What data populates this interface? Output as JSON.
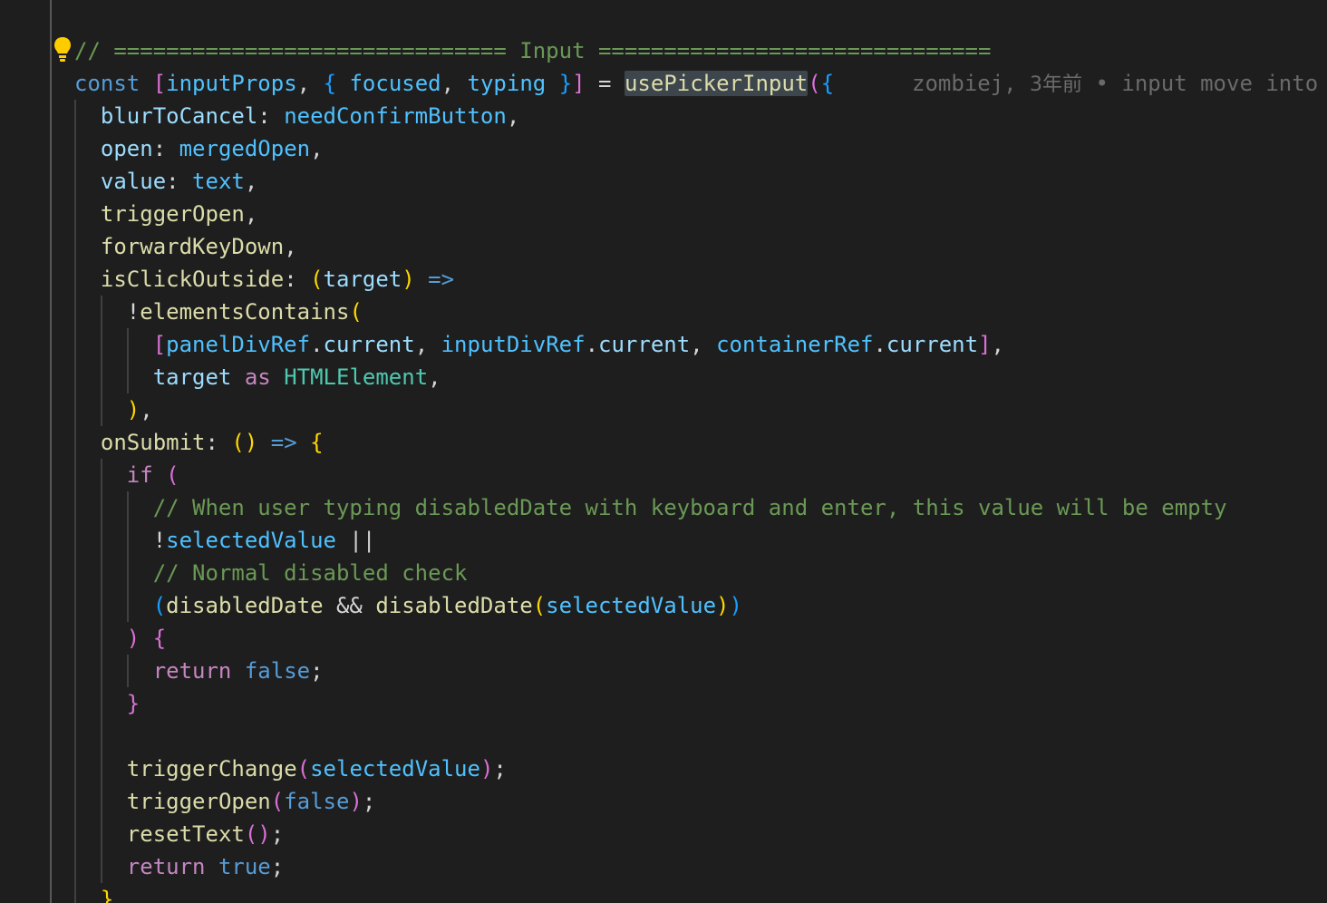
{
  "editor": {
    "colors": {
      "background": "#1e1e1e",
      "comment": "#6a9955",
      "keyword_storage": "#569cd6",
      "keyword_control": "#c586c0",
      "variable": "#9cdcfe",
      "constant": "#4fc1ff",
      "function": "#dcdcaa",
      "type": "#4ec9b0",
      "punctuation": "#d4d4d4",
      "bracket_gold": "#ffd700",
      "bracket_purple": "#da70d6",
      "bracket_blue": "#179fff",
      "indent_guide": "#404040",
      "blame": "#6a6a6a"
    },
    "code_lines": [
      {
        "indent": 0,
        "tokens": [
          {
            "text": "// ============================== Input ==============================",
            "kind": "comment"
          }
        ]
      },
      {
        "indent": 0,
        "tokens": [
          {
            "text": "const",
            "kind": "keyword_storage"
          },
          {
            "text": " ",
            "kind": "punctuation"
          },
          {
            "text": "[",
            "kind": "bracket_purple"
          },
          {
            "text": "inputProps",
            "kind": "constant"
          },
          {
            "text": ", ",
            "kind": "punctuation"
          },
          {
            "text": "{",
            "kind": "bracket_blue"
          },
          {
            "text": " ",
            "kind": "punctuation"
          },
          {
            "text": "focused",
            "kind": "constant"
          },
          {
            "text": ", ",
            "kind": "punctuation"
          },
          {
            "text": "typing",
            "kind": "constant"
          },
          {
            "text": " ",
            "kind": "punctuation"
          },
          {
            "text": "}",
            "kind": "bracket_blue"
          },
          {
            "text": "]",
            "kind": "bracket_purple"
          },
          {
            "text": " = ",
            "kind": "punctuation"
          },
          {
            "text": "usePickerInput",
            "kind": "function",
            "highlight": true
          },
          {
            "text": "(",
            "kind": "bracket_purple"
          },
          {
            "text": "{",
            "kind": "bracket_blue"
          }
        ]
      },
      {
        "indent": 1,
        "tokens": [
          {
            "text": "blurToCancel",
            "kind": "variable"
          },
          {
            "text": ": ",
            "kind": "punctuation"
          },
          {
            "text": "needConfirmButton",
            "kind": "constant"
          },
          {
            "text": ",",
            "kind": "punctuation"
          }
        ]
      },
      {
        "indent": 1,
        "tokens": [
          {
            "text": "open",
            "kind": "variable"
          },
          {
            "text": ": ",
            "kind": "punctuation"
          },
          {
            "text": "mergedOpen",
            "kind": "constant"
          },
          {
            "text": ",",
            "kind": "punctuation"
          }
        ]
      },
      {
        "indent": 1,
        "tokens": [
          {
            "text": "value",
            "kind": "variable"
          },
          {
            "text": ": ",
            "kind": "punctuation"
          },
          {
            "text": "text",
            "kind": "constant"
          },
          {
            "text": ",",
            "kind": "punctuation"
          }
        ]
      },
      {
        "indent": 1,
        "tokens": [
          {
            "text": "triggerOpen",
            "kind": "function"
          },
          {
            "text": ",",
            "kind": "punctuation"
          }
        ]
      },
      {
        "indent": 1,
        "tokens": [
          {
            "text": "forwardKeyDown",
            "kind": "function"
          },
          {
            "text": ",",
            "kind": "punctuation"
          }
        ]
      },
      {
        "indent": 1,
        "tokens": [
          {
            "text": "isClickOutside",
            "kind": "function"
          },
          {
            "text": ": ",
            "kind": "punctuation"
          },
          {
            "text": "(",
            "kind": "bracket_gold"
          },
          {
            "text": "target",
            "kind": "variable"
          },
          {
            "text": ")",
            "kind": "bracket_gold"
          },
          {
            "text": " ",
            "kind": "punctuation"
          },
          {
            "text": "=>",
            "kind": "keyword_storage"
          }
        ]
      },
      {
        "indent": 2,
        "tokens": [
          {
            "text": "!",
            "kind": "punctuation"
          },
          {
            "text": "elementsContains",
            "kind": "function"
          },
          {
            "text": "(",
            "kind": "bracket_gold"
          }
        ]
      },
      {
        "indent": 3,
        "tokens": [
          {
            "text": "[",
            "kind": "bracket_purple"
          },
          {
            "text": "panelDivRef",
            "kind": "constant"
          },
          {
            "text": ".",
            "kind": "punctuation"
          },
          {
            "text": "current",
            "kind": "variable"
          },
          {
            "text": ", ",
            "kind": "punctuation"
          },
          {
            "text": "inputDivRef",
            "kind": "constant"
          },
          {
            "text": ".",
            "kind": "punctuation"
          },
          {
            "text": "current",
            "kind": "variable"
          },
          {
            "text": ", ",
            "kind": "punctuation"
          },
          {
            "text": "containerRef",
            "kind": "constant"
          },
          {
            "text": ".",
            "kind": "punctuation"
          },
          {
            "text": "current",
            "kind": "variable"
          },
          {
            "text": "]",
            "kind": "bracket_purple"
          },
          {
            "text": ",",
            "kind": "punctuation"
          }
        ]
      },
      {
        "indent": 3,
        "tokens": [
          {
            "text": "target",
            "kind": "variable"
          },
          {
            "text": " ",
            "kind": "punctuation"
          },
          {
            "text": "as",
            "kind": "keyword_control"
          },
          {
            "text": " ",
            "kind": "punctuation"
          },
          {
            "text": "HTMLElement",
            "kind": "type"
          },
          {
            "text": ",",
            "kind": "punctuation"
          }
        ]
      },
      {
        "indent": 2,
        "tokens": [
          {
            "text": ")",
            "kind": "bracket_gold"
          },
          {
            "text": ",",
            "kind": "punctuation"
          }
        ]
      },
      {
        "indent": 1,
        "tokens": [
          {
            "text": "onSubmit",
            "kind": "function"
          },
          {
            "text": ": ",
            "kind": "punctuation"
          },
          {
            "text": "()",
            "kind": "bracket_gold"
          },
          {
            "text": " ",
            "kind": "punctuation"
          },
          {
            "text": "=>",
            "kind": "keyword_storage"
          },
          {
            "text": " ",
            "kind": "punctuation"
          },
          {
            "text": "{",
            "kind": "bracket_gold"
          }
        ]
      },
      {
        "indent": 2,
        "tokens": [
          {
            "text": "if",
            "kind": "keyword_control"
          },
          {
            "text": " ",
            "kind": "punctuation"
          },
          {
            "text": "(",
            "kind": "bracket_purple"
          }
        ]
      },
      {
        "indent": 3,
        "tokens": [
          {
            "text": "// When user typing disabledDate with keyboard and enter, this value will be empty",
            "kind": "comment"
          }
        ]
      },
      {
        "indent": 3,
        "tokens": [
          {
            "text": "!",
            "kind": "punctuation"
          },
          {
            "text": "selectedValue",
            "kind": "constant"
          },
          {
            "text": " ||",
            "kind": "punctuation"
          }
        ]
      },
      {
        "indent": 3,
        "tokens": [
          {
            "text": "// Normal disabled check",
            "kind": "comment"
          }
        ]
      },
      {
        "indent": 3,
        "tokens": [
          {
            "text": "(",
            "kind": "bracket_blue"
          },
          {
            "text": "disabledDate",
            "kind": "function"
          },
          {
            "text": " && ",
            "kind": "punctuation"
          },
          {
            "text": "disabledDate",
            "kind": "function"
          },
          {
            "text": "(",
            "kind": "bracket_gold"
          },
          {
            "text": "selectedValue",
            "kind": "constant"
          },
          {
            "text": ")",
            "kind": "bracket_gold"
          },
          {
            "text": ")",
            "kind": "bracket_blue"
          }
        ]
      },
      {
        "indent": 2,
        "tokens": [
          {
            "text": ")",
            "kind": "bracket_purple"
          },
          {
            "text": " ",
            "kind": "punctuation"
          },
          {
            "text": "{",
            "kind": "bracket_purple"
          }
        ]
      },
      {
        "indent": 3,
        "tokens": [
          {
            "text": "return",
            "kind": "keyword_control"
          },
          {
            "text": " ",
            "kind": "punctuation"
          },
          {
            "text": "false",
            "kind": "keyword_storage"
          },
          {
            "text": ";",
            "kind": "punctuation"
          }
        ]
      },
      {
        "indent": 2,
        "tokens": [
          {
            "text": "}",
            "kind": "bracket_purple"
          }
        ]
      },
      {
        "indent": 0,
        "tokens": []
      },
      {
        "indent": 2,
        "tokens": [
          {
            "text": "triggerChange",
            "kind": "function"
          },
          {
            "text": "(",
            "kind": "bracket_purple"
          },
          {
            "text": "selectedValue",
            "kind": "constant"
          },
          {
            "text": ")",
            "kind": "bracket_purple"
          },
          {
            "text": ";",
            "kind": "punctuation"
          }
        ]
      },
      {
        "indent": 2,
        "tokens": [
          {
            "text": "triggerOpen",
            "kind": "function"
          },
          {
            "text": "(",
            "kind": "bracket_purple"
          },
          {
            "text": "false",
            "kind": "keyword_storage"
          },
          {
            "text": ")",
            "kind": "bracket_purple"
          },
          {
            "text": ";",
            "kind": "punctuation"
          }
        ]
      },
      {
        "indent": 2,
        "tokens": [
          {
            "text": "resetText",
            "kind": "function"
          },
          {
            "text": "()",
            "kind": "bracket_purple"
          },
          {
            "text": ";",
            "kind": "punctuation"
          }
        ]
      },
      {
        "indent": 2,
        "tokens": [
          {
            "text": "return",
            "kind": "keyword_control"
          },
          {
            "text": " ",
            "kind": "punctuation"
          },
          {
            "text": "true",
            "kind": "keyword_storage"
          },
          {
            "text": ";",
            "kind": "punctuation"
          }
        ]
      },
      {
        "indent": 1,
        "tokens": [
          {
            "text": "},",
            "kind": "bracket_gold"
          }
        ]
      }
    ],
    "blame": {
      "author": "zombiej, ",
      "time": "3年前",
      "separator": " • ",
      "message": "input move into"
    },
    "lightbulb_icon": "lightbulb-icon"
  }
}
